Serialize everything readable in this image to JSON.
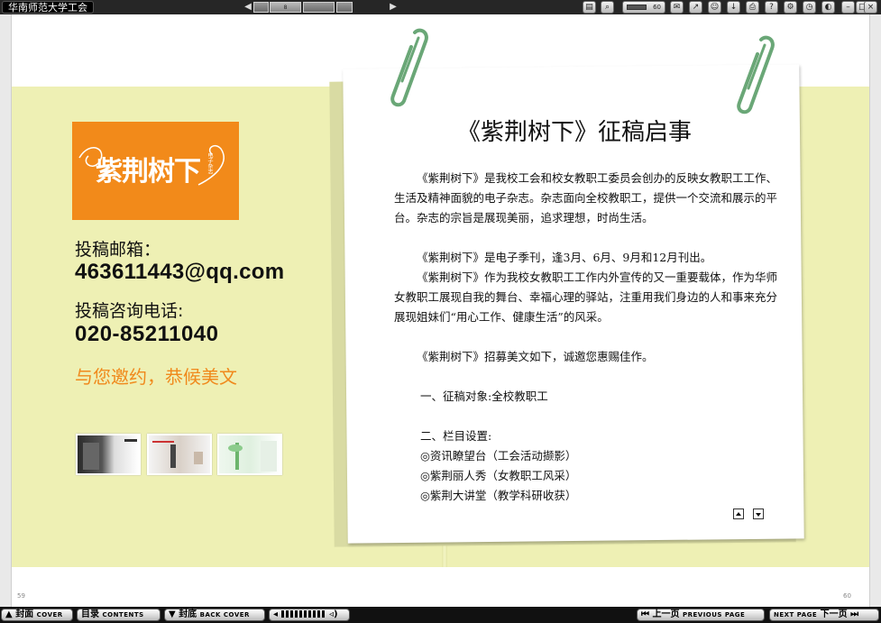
{
  "topbar": {
    "title": "华南师范大学工会",
    "page_nav": {
      "current_marker": "8"
    },
    "zoom_value": "60",
    "tools": [
      {
        "name": "thumbnails-icon",
        "glyph": "▤"
      },
      {
        "name": "search-icon",
        "glyph": "⌕"
      },
      {
        "name": "comment-icon",
        "glyph": "✉"
      },
      {
        "name": "share-icon",
        "glyph": "↗"
      },
      {
        "name": "user-icon",
        "glyph": "☺"
      },
      {
        "name": "download-icon",
        "glyph": "↓"
      },
      {
        "name": "print-icon",
        "glyph": "⎙"
      },
      {
        "name": "help-icon",
        "glyph": "?"
      },
      {
        "name": "settings-icon",
        "glyph": "⚙"
      },
      {
        "name": "clock-icon",
        "glyph": "◷"
      },
      {
        "name": "theme-icon",
        "glyph": "◐"
      },
      {
        "name": "minimize-icon",
        "glyph": "–"
      },
      {
        "name": "maximize-icon",
        "glyph": "□"
      },
      {
        "name": "close-icon",
        "glyph": "×"
      }
    ]
  },
  "left_page": {
    "logo_text": "紫荆树下",
    "logo_sub": "电子杂志",
    "email_label": "投稿邮箱：",
    "email_value": "463611443@qq.com",
    "phone_label": "投稿咨询电话:",
    "phone_value": "020-85211040",
    "slogan": "与您邀约，恭候美文",
    "page_number": "59"
  },
  "notice": {
    "title": "《紫荆树下》征稿启事",
    "paragraphs": [
      "《紫荆树下》是我校工会和校女教职工委员会创办的反映女教职工工作、生活及精神面貌的电子杂志。杂志面向全校教职工，提供一个交流和展示的平台。杂志的宗旨是展现美丽，追求理想，时尚生活。",
      "《紫荆树下》是电子季刊，逢3月、6月、9月和12月刊出。",
      "《紫荆树下》作为我校女教职工工作内外宣传的又一重要载体，作为华师女教职工展现自我的舞台、幸福心理的驿站，注重用我们身边的人和事来充分展现姐妹们“用心工作、健康生活”的风采。",
      "《紫荆树下》招募美文如下，诚邀您惠赐佳作。"
    ],
    "section_1": "一、征稿对象:全校教职工",
    "section_2": "二、栏目设置:",
    "columns": [
      "◎资讯瞭望台（工会活动撷影）",
      "◎紫荆丽人秀（女教职工风采）",
      "◎紫荆大讲堂（教学科研收获）"
    ],
    "page_number": "60"
  },
  "bottombar": {
    "cover": {
      "cn": "封面",
      "en": "COVER"
    },
    "contents": {
      "cn": "目录",
      "en": "CONTENTS"
    },
    "back_cover": {
      "cn": "封底",
      "en": "BACK COVER"
    },
    "prev": {
      "cn": "上一页",
      "en": "PREVIOUS PAGE"
    },
    "next": {
      "cn": "下一页",
      "en": "NEXT PAGE"
    }
  },
  "colors": {
    "accent_orange": "#f28a1a",
    "band_yellow": "#eef0b4",
    "clip_green": "#6aa777"
  }
}
